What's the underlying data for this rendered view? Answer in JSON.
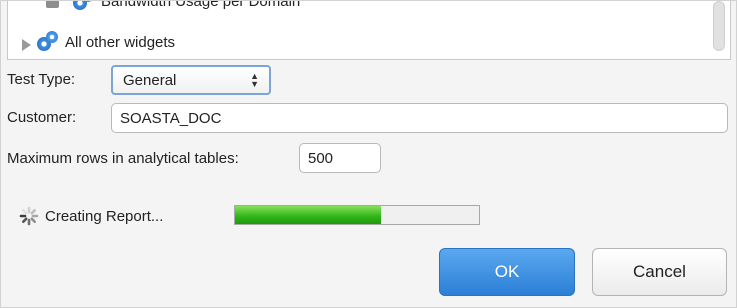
{
  "widgets": {
    "partial_item": "Bandwidth Usage per Domain",
    "other_item": "All other widgets"
  },
  "form": {
    "test_type_label": "Test Type:",
    "test_type_value": "General",
    "customer_label": "Customer:",
    "customer_value": "SOASTA_DOC",
    "max_rows_label": "Maximum rows in analytical tables:",
    "max_rows_value": "500"
  },
  "status": {
    "text": "Creating Report...",
    "progress": 0.6
  },
  "buttons": {
    "ok": "OK",
    "cancel": "Cancel"
  },
  "colors": {
    "accent": "#2b7fd6",
    "progress": "#2fb317"
  }
}
